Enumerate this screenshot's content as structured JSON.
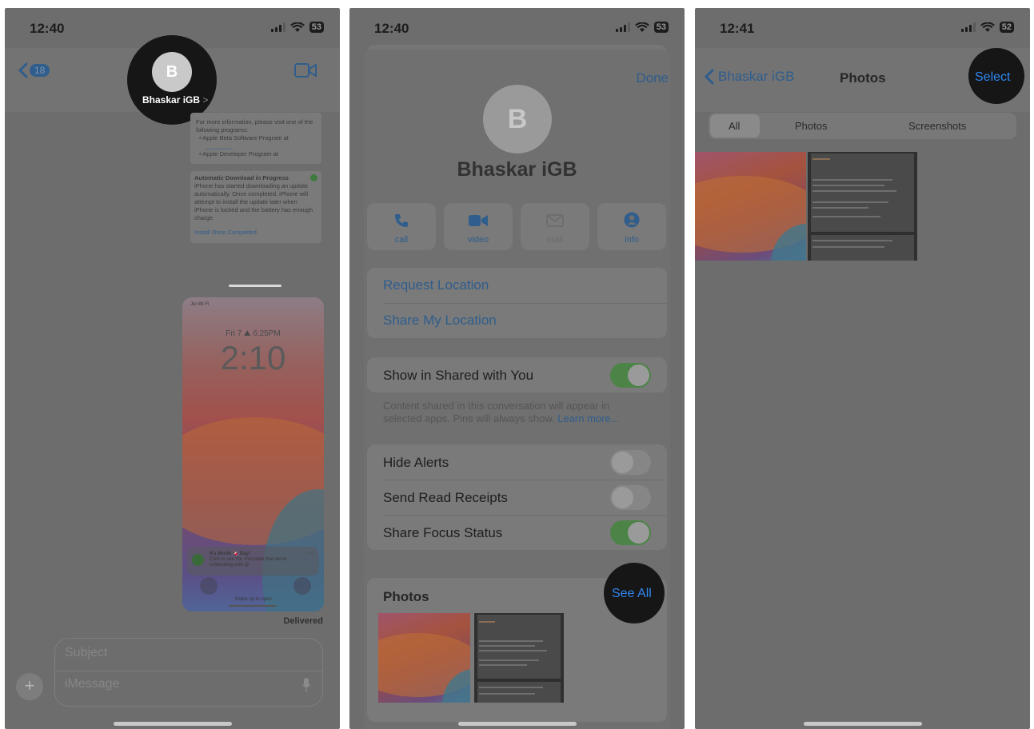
{
  "panel1": {
    "status": {
      "time": "12:40",
      "battery": "53"
    },
    "header": {
      "back_count": "18",
      "avatar_letter": "B",
      "contact_name": "Bhaskar iGB",
      "chevron": ">"
    },
    "message1": {
      "lines": [
        "For more information, please visit one of the",
        "following programs:"
      ],
      "bullets": [
        "Apple Beta Software Program at",
        "Apple Developer Program at"
      ]
    },
    "message2": {
      "title": "Automatic Download in Progress",
      "body": "iPhone has started downloading an update automatically. Once completed, iPhone will attempt to install the update later when iPhone is locked and the battery has enough charge.",
      "link": "Install Once Completed"
    },
    "screenshot": {
      "status_left": "Jio Wi-Fi",
      "date": "Fri 7  ⛰ 6:25PM",
      "clock": "2:10",
      "notification_title": "It's World 🍫 Day!",
      "notification_body": "Click to see the chocolate that we're celebrating with 😋",
      "notification_time": "now",
      "swipe": "Swipe up to open"
    },
    "delivered": "Delivered",
    "composer": {
      "subject_placeholder": "Subject",
      "message_placeholder": "iMessage"
    }
  },
  "panel2": {
    "status": {
      "time": "12:40",
      "battery": "53"
    },
    "done": "Done",
    "avatar_letter": "B",
    "contact_name": "Bhaskar iGB",
    "actions": [
      "call",
      "video",
      "mail",
      "info"
    ],
    "location": [
      "Request Location",
      "Share My Location"
    ],
    "shared_with_you": {
      "label": "Show in Shared with You",
      "on": true,
      "footnote": "Content shared in this conversation will appear in selected apps. Pins will always show.",
      "learn_more": "Learn more..."
    },
    "toggles": [
      {
        "label": "Hide Alerts",
        "on": false
      },
      {
        "label": "Send Read Receipts",
        "on": false
      },
      {
        "label": "Share Focus Status",
        "on": true
      }
    ],
    "photos": {
      "title": "Photos",
      "see_all": "See All"
    }
  },
  "panel3": {
    "status": {
      "time": "12:41",
      "battery": "52"
    },
    "back_label": "Bhaskar iGB",
    "title": "Photos",
    "select": "Select",
    "segments": [
      "All",
      "Photos",
      "Screenshots"
    ],
    "selected_segment": "All"
  },
  "colors": {
    "accent": "#2f86f2",
    "toggle_on": "#4c8447",
    "dim_overlay": "#6d6d6d"
  }
}
